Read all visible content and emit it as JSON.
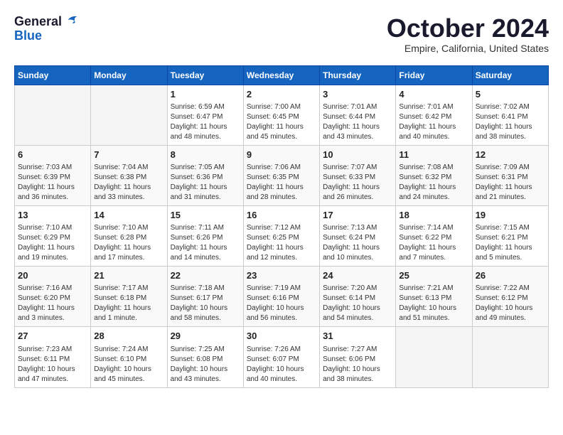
{
  "header": {
    "logo_line1": "General",
    "logo_line2": "Blue",
    "month_title": "October 2024",
    "location": "Empire, California, United States"
  },
  "weekdays": [
    "Sunday",
    "Monday",
    "Tuesday",
    "Wednesday",
    "Thursday",
    "Friday",
    "Saturday"
  ],
  "weeks": [
    [
      {
        "day": "",
        "sunrise": "",
        "sunset": "",
        "daylight": ""
      },
      {
        "day": "",
        "sunrise": "",
        "sunset": "",
        "daylight": ""
      },
      {
        "day": "1",
        "sunrise": "Sunrise: 6:59 AM",
        "sunset": "Sunset: 6:47 PM",
        "daylight": "Daylight: 11 hours and 48 minutes."
      },
      {
        "day": "2",
        "sunrise": "Sunrise: 7:00 AM",
        "sunset": "Sunset: 6:45 PM",
        "daylight": "Daylight: 11 hours and 45 minutes."
      },
      {
        "day": "3",
        "sunrise": "Sunrise: 7:01 AM",
        "sunset": "Sunset: 6:44 PM",
        "daylight": "Daylight: 11 hours and 43 minutes."
      },
      {
        "day": "4",
        "sunrise": "Sunrise: 7:01 AM",
        "sunset": "Sunset: 6:42 PM",
        "daylight": "Daylight: 11 hours and 40 minutes."
      },
      {
        "day": "5",
        "sunrise": "Sunrise: 7:02 AM",
        "sunset": "Sunset: 6:41 PM",
        "daylight": "Daylight: 11 hours and 38 minutes."
      }
    ],
    [
      {
        "day": "6",
        "sunrise": "Sunrise: 7:03 AM",
        "sunset": "Sunset: 6:39 PM",
        "daylight": "Daylight: 11 hours and 36 minutes."
      },
      {
        "day": "7",
        "sunrise": "Sunrise: 7:04 AM",
        "sunset": "Sunset: 6:38 PM",
        "daylight": "Daylight: 11 hours and 33 minutes."
      },
      {
        "day": "8",
        "sunrise": "Sunrise: 7:05 AM",
        "sunset": "Sunset: 6:36 PM",
        "daylight": "Daylight: 11 hours and 31 minutes."
      },
      {
        "day": "9",
        "sunrise": "Sunrise: 7:06 AM",
        "sunset": "Sunset: 6:35 PM",
        "daylight": "Daylight: 11 hours and 28 minutes."
      },
      {
        "day": "10",
        "sunrise": "Sunrise: 7:07 AM",
        "sunset": "Sunset: 6:33 PM",
        "daylight": "Daylight: 11 hours and 26 minutes."
      },
      {
        "day": "11",
        "sunrise": "Sunrise: 7:08 AM",
        "sunset": "Sunset: 6:32 PM",
        "daylight": "Daylight: 11 hours and 24 minutes."
      },
      {
        "day": "12",
        "sunrise": "Sunrise: 7:09 AM",
        "sunset": "Sunset: 6:31 PM",
        "daylight": "Daylight: 11 hours and 21 minutes."
      }
    ],
    [
      {
        "day": "13",
        "sunrise": "Sunrise: 7:10 AM",
        "sunset": "Sunset: 6:29 PM",
        "daylight": "Daylight: 11 hours and 19 minutes."
      },
      {
        "day": "14",
        "sunrise": "Sunrise: 7:10 AM",
        "sunset": "Sunset: 6:28 PM",
        "daylight": "Daylight: 11 hours and 17 minutes."
      },
      {
        "day": "15",
        "sunrise": "Sunrise: 7:11 AM",
        "sunset": "Sunset: 6:26 PM",
        "daylight": "Daylight: 11 hours and 14 minutes."
      },
      {
        "day": "16",
        "sunrise": "Sunrise: 7:12 AM",
        "sunset": "Sunset: 6:25 PM",
        "daylight": "Daylight: 11 hours and 12 minutes."
      },
      {
        "day": "17",
        "sunrise": "Sunrise: 7:13 AM",
        "sunset": "Sunset: 6:24 PM",
        "daylight": "Daylight: 11 hours and 10 minutes."
      },
      {
        "day": "18",
        "sunrise": "Sunrise: 7:14 AM",
        "sunset": "Sunset: 6:22 PM",
        "daylight": "Daylight: 11 hours and 7 minutes."
      },
      {
        "day": "19",
        "sunrise": "Sunrise: 7:15 AM",
        "sunset": "Sunset: 6:21 PM",
        "daylight": "Daylight: 11 hours and 5 minutes."
      }
    ],
    [
      {
        "day": "20",
        "sunrise": "Sunrise: 7:16 AM",
        "sunset": "Sunset: 6:20 PM",
        "daylight": "Daylight: 11 hours and 3 minutes."
      },
      {
        "day": "21",
        "sunrise": "Sunrise: 7:17 AM",
        "sunset": "Sunset: 6:18 PM",
        "daylight": "Daylight: 11 hours and 1 minute."
      },
      {
        "day": "22",
        "sunrise": "Sunrise: 7:18 AM",
        "sunset": "Sunset: 6:17 PM",
        "daylight": "Daylight: 10 hours and 58 minutes."
      },
      {
        "day": "23",
        "sunrise": "Sunrise: 7:19 AM",
        "sunset": "Sunset: 6:16 PM",
        "daylight": "Daylight: 10 hours and 56 minutes."
      },
      {
        "day": "24",
        "sunrise": "Sunrise: 7:20 AM",
        "sunset": "Sunset: 6:14 PM",
        "daylight": "Daylight: 10 hours and 54 minutes."
      },
      {
        "day": "25",
        "sunrise": "Sunrise: 7:21 AM",
        "sunset": "Sunset: 6:13 PM",
        "daylight": "Daylight: 10 hours and 51 minutes."
      },
      {
        "day": "26",
        "sunrise": "Sunrise: 7:22 AM",
        "sunset": "Sunset: 6:12 PM",
        "daylight": "Daylight: 10 hours and 49 minutes."
      }
    ],
    [
      {
        "day": "27",
        "sunrise": "Sunrise: 7:23 AM",
        "sunset": "Sunset: 6:11 PM",
        "daylight": "Daylight: 10 hours and 47 minutes."
      },
      {
        "day": "28",
        "sunrise": "Sunrise: 7:24 AM",
        "sunset": "Sunset: 6:10 PM",
        "daylight": "Daylight: 10 hours and 45 minutes."
      },
      {
        "day": "29",
        "sunrise": "Sunrise: 7:25 AM",
        "sunset": "Sunset: 6:08 PM",
        "daylight": "Daylight: 10 hours and 43 minutes."
      },
      {
        "day": "30",
        "sunrise": "Sunrise: 7:26 AM",
        "sunset": "Sunset: 6:07 PM",
        "daylight": "Daylight: 10 hours and 40 minutes."
      },
      {
        "day": "31",
        "sunrise": "Sunrise: 7:27 AM",
        "sunset": "Sunset: 6:06 PM",
        "daylight": "Daylight: 10 hours and 38 minutes."
      },
      {
        "day": "",
        "sunrise": "",
        "sunset": "",
        "daylight": ""
      },
      {
        "day": "",
        "sunrise": "",
        "sunset": "",
        "daylight": ""
      }
    ]
  ]
}
